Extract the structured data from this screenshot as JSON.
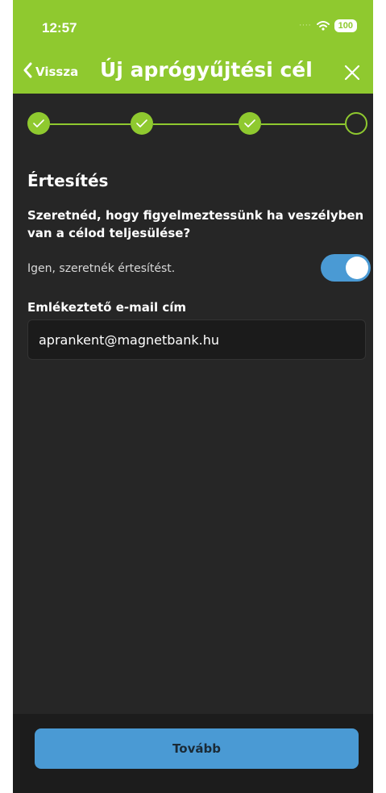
{
  "status_bar": {
    "time": "12:57",
    "battery": "100"
  },
  "nav": {
    "back_label": "Vissza",
    "title": "Új aprógyűjtési cél"
  },
  "stepper": {
    "steps": [
      {
        "state": "done"
      },
      {
        "state": "done"
      },
      {
        "state": "done"
      },
      {
        "state": "current"
      }
    ]
  },
  "content": {
    "section_title": "Értesítés",
    "question": "Szeretnéd, hogy figyelmeztessünk ha veszélyben van a célod teljesülése?",
    "toggle_label": "Igen, szeretnék értesítést.",
    "toggle_on": true,
    "email_label": "Emlékeztető e-mail cím",
    "email_value": "aprankent@magnetbank.hu"
  },
  "footer": {
    "next_label": "Tovább"
  },
  "colors": {
    "brand_green": "#8fc92f",
    "accent_blue": "#4a9ad4",
    "background": "#262626"
  }
}
